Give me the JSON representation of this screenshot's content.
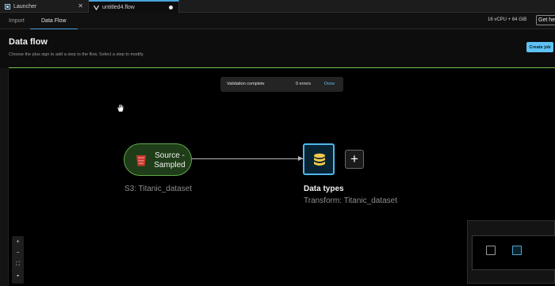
{
  "tabs": [
    {
      "label": "Launcher",
      "close": "✕"
    },
    {
      "label": "untitled4.flow"
    }
  ],
  "subtabs": {
    "import": "Import",
    "data_flow": "Data Flow"
  },
  "resources": "16 vCPU + 64 GiB",
  "help_label": "Get help",
  "page": {
    "title": "Data flow",
    "subtitle": "Choose the plus sign to add a step to the flow. Select a step to modify.",
    "create_job": "Create job"
  },
  "validation": {
    "text": "Validation complete",
    "errors": "0 errors",
    "done": "Done"
  },
  "source_node": {
    "label": "Source - Sampled",
    "caption": "S3: Titanic_dataset"
  },
  "transform_node": {
    "title": "Data types",
    "caption": "Transform: Titanic_dataset"
  },
  "plus": "+",
  "zoom": {
    "in": "+",
    "out": "−",
    "fit": "⛶",
    "lock": "▪"
  },
  "colors": {
    "accent": "#4fb7ea",
    "source_green": "#5fa84a",
    "progress_line": "#7ac74f"
  },
  "icons": [
    "launcher-icon",
    "flow-icon",
    "hand-cursor-icon",
    "s3-bucket-icon",
    "database-icon"
  ]
}
